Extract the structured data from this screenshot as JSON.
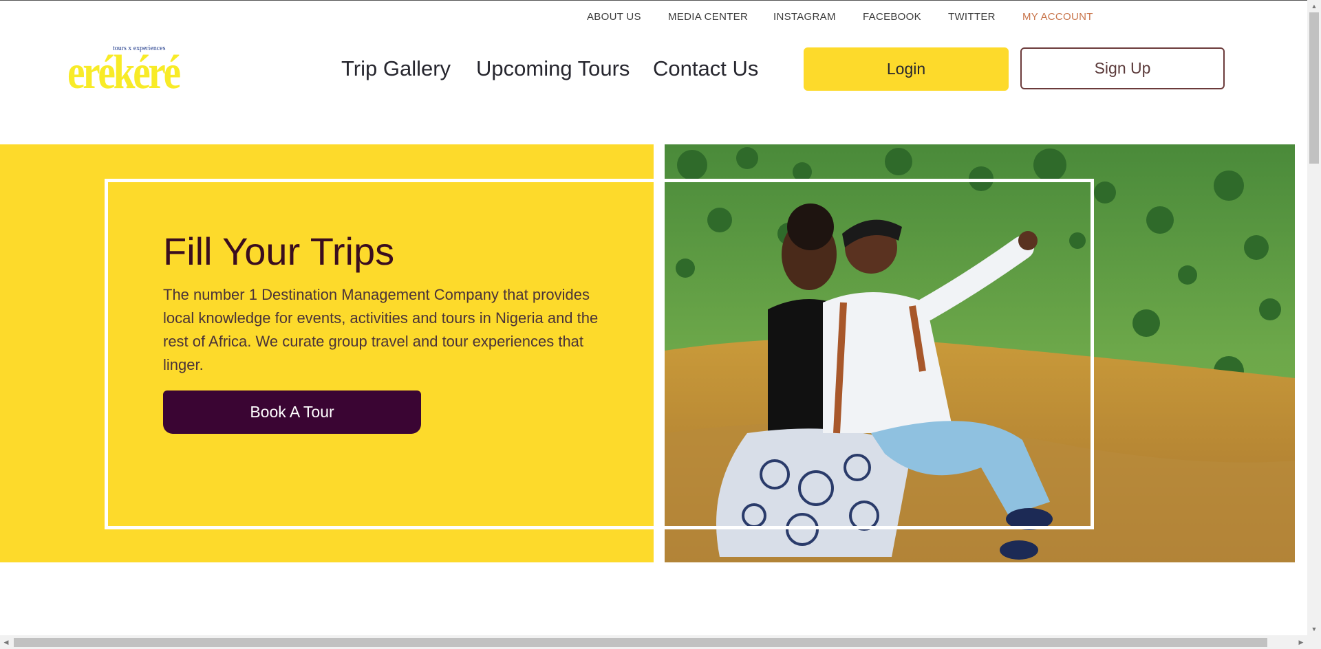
{
  "util_nav": {
    "items": [
      "ABOUT US",
      "MEDIA CENTER",
      "INSTAGRAM",
      "FACEBOOK",
      "TWITTER",
      "MY ACCOUNT"
    ]
  },
  "logo": {
    "word": "erékéré",
    "tagline": "tours x experiences"
  },
  "main_nav": {
    "items": [
      "Trip Gallery",
      "Upcoming Tours",
      "Contact Us"
    ],
    "login_label": "Login",
    "signup_label": "Sign Up"
  },
  "hero": {
    "title": "Fill Your Trips",
    "description": "The number 1 Destination Management Company that provides local knowledge for events, activities and tours in Nigeria and the rest of Africa. We curate group travel and tour experiences that linger.",
    "cta_label": "Book A Tour",
    "photo_alt": "Two women sitting on a rock pointing across a green valley"
  },
  "colors": {
    "brand_yellow": "#fdda2b",
    "cta_purple": "#3a0533",
    "title_maroon": "#3a0d1f",
    "account_link": "#c8744a"
  }
}
